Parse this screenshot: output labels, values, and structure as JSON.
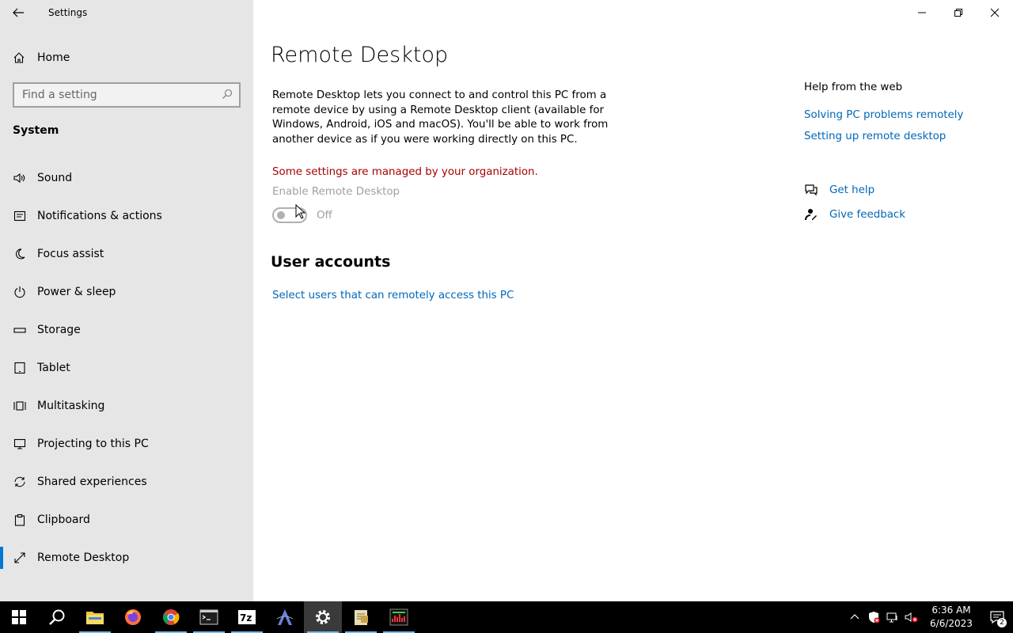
{
  "window": {
    "app_title": "Settings"
  },
  "sidebar": {
    "home_label": "Home",
    "search_placeholder": "Find a setting",
    "section_label": "System",
    "items": [
      {
        "label": "Sound",
        "icon": "speaker-icon"
      },
      {
        "label": "Notifications & actions",
        "icon": "notifications-icon"
      },
      {
        "label": "Focus assist",
        "icon": "moon-icon"
      },
      {
        "label": "Power & sleep",
        "icon": "power-icon"
      },
      {
        "label": "Storage",
        "icon": "storage-icon"
      },
      {
        "label": "Tablet",
        "icon": "tablet-icon"
      },
      {
        "label": "Multitasking",
        "icon": "multitasking-icon"
      },
      {
        "label": "Projecting to this PC",
        "icon": "projecting-icon"
      },
      {
        "label": "Shared experiences",
        "icon": "shared-experiences-icon"
      },
      {
        "label": "Clipboard",
        "icon": "clipboard-icon"
      },
      {
        "label": "Remote Desktop",
        "icon": "remote-desktop-icon",
        "selected": true
      }
    ]
  },
  "main": {
    "title": "Remote Desktop",
    "description": "Remote Desktop lets you connect to and control this PC from a remote device by using a Remote Desktop client (available for Windows, Android, iOS and macOS). You'll be able to work from another device as if you were working directly on this PC.",
    "org_message": "Some settings are managed by your organization.",
    "enable_label": "Enable Remote Desktop",
    "toggle_state": "Off",
    "user_accounts_heading": "User accounts",
    "users_link": "Select users that can remotely access this PC"
  },
  "help": {
    "heading": "Help from the web",
    "links": [
      "Solving PC problems remotely",
      "Setting up remote desktop"
    ],
    "get_help": "Get help",
    "give_feedback": "Give feedback"
  },
  "taskbar": {
    "apps": [
      "start-icon",
      "search-icon",
      "file-explorer-icon",
      "firefox-icon",
      "chrome-icon",
      "terminal-icon",
      "7zip-icon",
      "app-a-icon",
      "settings-icon",
      "notepad-icon",
      "audio-app-icon"
    ],
    "time": "6:36 AM",
    "date": "6/6/2023",
    "notification_count": "2"
  },
  "colors": {
    "accent": "#0078d4",
    "link": "#0067b8",
    "warning": "#a80000",
    "sidebar_bg": "#e6e6e6",
    "taskbar_bg": "#000000"
  }
}
